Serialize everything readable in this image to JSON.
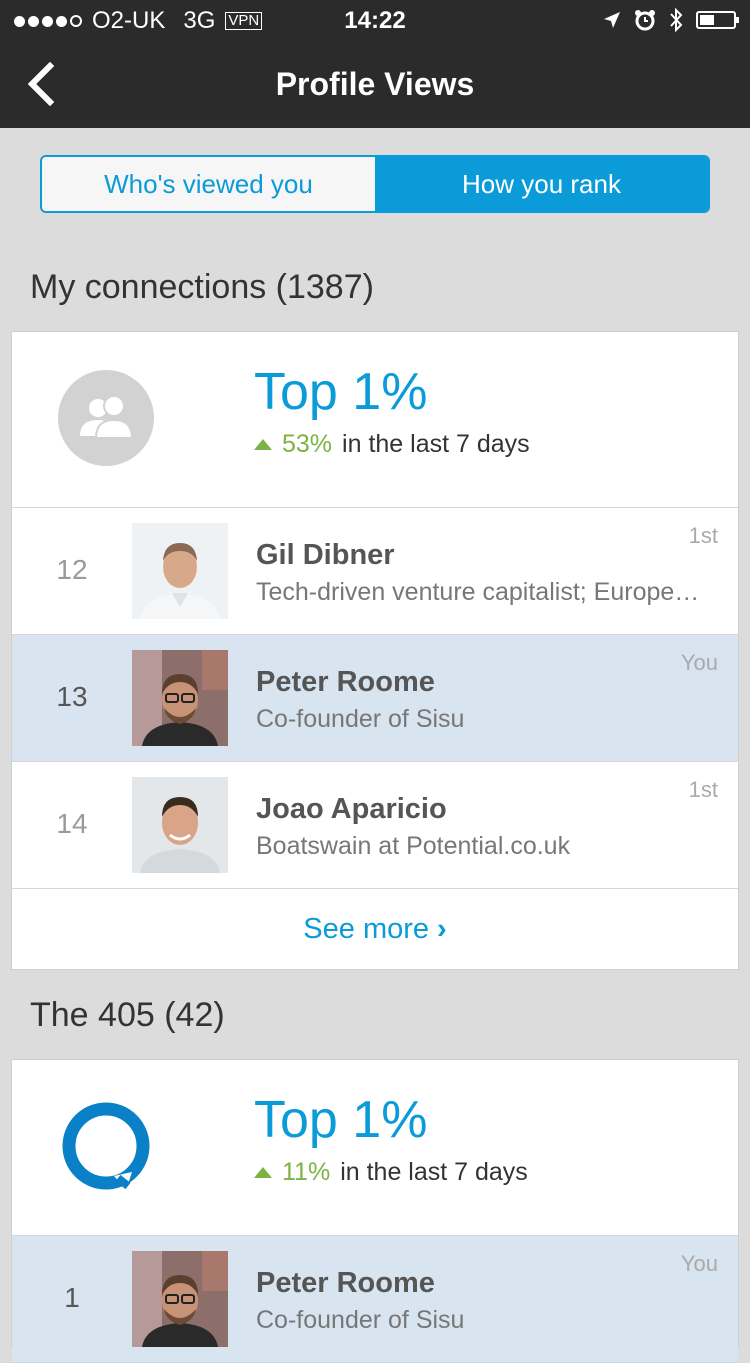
{
  "status_bar": {
    "carrier": "O2-UK",
    "network": "3G",
    "vpn": "VPN",
    "time": "14:22",
    "icons": [
      "location-arrow-icon",
      "alarm-icon",
      "bluetooth-icon",
      "battery-icon"
    ]
  },
  "nav": {
    "title": "Profile Views",
    "back_icon": "chevron-left-icon"
  },
  "tabs": [
    {
      "label": "Who's viewed you",
      "active": false
    },
    {
      "label": "How you rank",
      "active": true
    }
  ],
  "sections": [
    {
      "title": "My connections (1387)",
      "rank": "Top 1%",
      "trend_pct": "53%",
      "trend_text": "in the last 7 days",
      "rows": [
        {
          "rank": "12",
          "name": "Gil Dibner",
          "headline": "Tech-driven venture capitalist; Europe…",
          "degree": "1st"
        },
        {
          "rank": "13",
          "name": "Peter Roome",
          "headline": "Co-founder of Sisu",
          "degree": "You"
        },
        {
          "rank": "14",
          "name": "Joao Aparicio",
          "headline": "Boatswain at Potential.co.uk",
          "degree": "1st"
        }
      ],
      "see_more": "See more",
      "see_more_chevron": "›"
    },
    {
      "title": "The 405 (42)",
      "rank": "Top 1%",
      "trend_pct": "11%",
      "trend_text": "in the last 7 days",
      "rows": [
        {
          "rank": "1",
          "name": "Peter Roome",
          "headline": "Co-founder of Sisu",
          "degree": "You"
        }
      ]
    }
  ],
  "colors": {
    "accent": "#0a9bd8",
    "trend_up": "#7cb342",
    "highlight_row": "#d9e4f1",
    "nav_bg": "#2b2b2b"
  }
}
